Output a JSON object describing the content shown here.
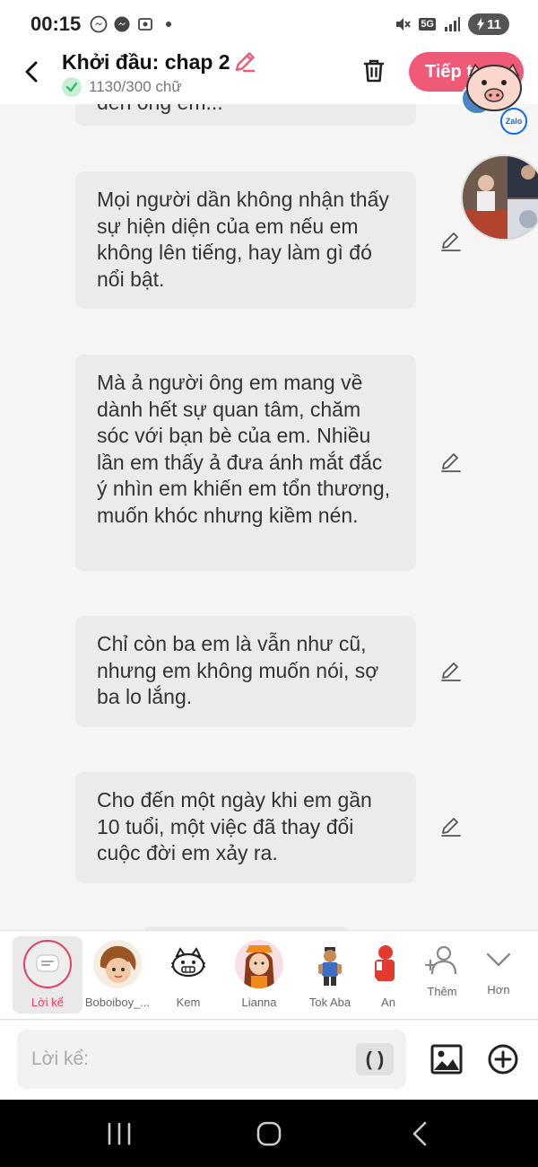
{
  "status_bar": {
    "time": "00:15",
    "network": "5G",
    "battery": "11"
  },
  "header": {
    "title": "Khởi đầu: chap 2",
    "word_count": "1130/300 chữ",
    "continue_label": "Tiếp t"
  },
  "floating": {
    "zalo_label": "Zalo"
  },
  "messages": [
    {
      "text": "đến ông em..."
    },
    {
      "text": "Mọi người dần không nhận thấy sự hiện diện của em nếu em không lên tiếng, hay làm gì đó nổi bật."
    },
    {
      "text": "Mà ả người ông em mang về dành hết sự quan tâm, chăm sóc với bạn bè của em. Nhiều lần em thấy ả đưa ánh mắt đắc ý nhìn em khiến em tổn thương, muốn khóc nhưng kiềm nén."
    },
    {
      "text": "Chỉ còn ba em là vẫn như cũ, nhưng em không muốn nói, sợ ba lo lắng."
    },
    {
      "text": "Cho đến một ngày khi em gần 10 tuổi, một việc đã thay đổi cuộc đời em xảy ra."
    }
  ],
  "characters": [
    {
      "label": "Lời kể",
      "selected": true
    },
    {
      "label": "Boboiboy_..."
    },
    {
      "label": "Kem"
    },
    {
      "label": "Lianna"
    },
    {
      "label": "Tok Aba"
    },
    {
      "label": "An"
    },
    {
      "label": "Thêm"
    },
    {
      "label": "Hơn"
    }
  ],
  "input": {
    "placeholder": "Lời kể:",
    "paren_label": "( )"
  },
  "colors": {
    "accent": "#f05a78",
    "bubble_bg": "#ebebeb",
    "chat_bg": "#f5f5f5",
    "nav_bg": "#000000"
  },
  "icons": [
    "back-arrow-icon",
    "pencil-icon",
    "check-icon",
    "trash-icon",
    "image-icon",
    "plus-circle-icon",
    "add-person-icon",
    "chevron-down-icon",
    "recents-icon",
    "home-icon",
    "nav-back-icon"
  ]
}
